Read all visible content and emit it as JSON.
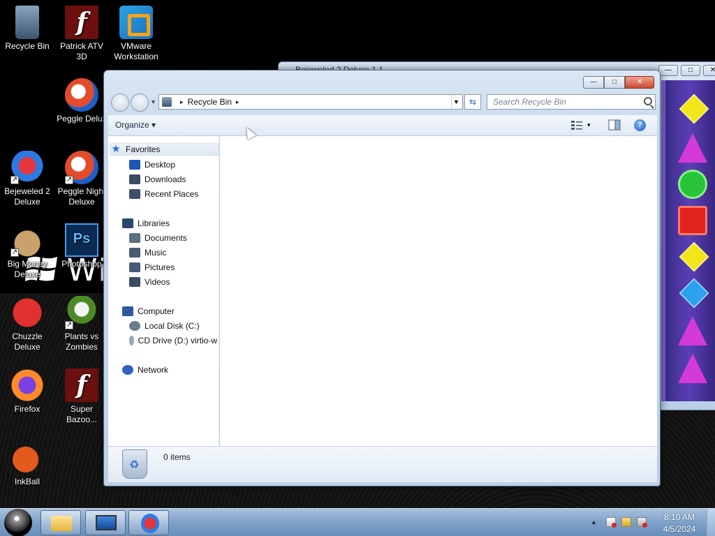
{
  "desktop": {
    "icons": [
      {
        "label": "Recycle Bin",
        "icon": "recycle-bin-icon"
      },
      {
        "label": "Patrick ATV\n3D",
        "icon": "flash-icon"
      },
      {
        "label": "VMware\nWorkstation",
        "icon": "vmware-icon"
      },
      {
        "label": "Peggle Delux",
        "icon": "peggle-icon"
      },
      {
        "label": "Bejeweled 2\nDeluxe",
        "icon": "bejeweled-icon"
      },
      {
        "label": "Peggle Night\nDeluxe",
        "icon": "peggle-icon"
      },
      {
        "label": "Big Money\nDeluxe",
        "icon": "money-bag-icon"
      },
      {
        "label": "Photoshop",
        "icon": "photoshop-icon"
      },
      {
        "label": "Chuzzle\nDeluxe",
        "icon": "chuzzle-icon"
      },
      {
        "label": "Plants vs\nZombies",
        "icon": "plants-vs-zombies-icon"
      },
      {
        "label": "Firefox",
        "icon": "firefox-icon"
      },
      {
        "label": "Super\nBazoo...",
        "icon": "flash-icon"
      },
      {
        "label": "InkBall",
        "icon": "inkball-icon"
      }
    ],
    "wallpaper_text": "Wi"
  },
  "bejeweled_window": {
    "title": "Bejeweled 2 Deluxe 1.1",
    "controls": [
      "—",
      "□",
      "✕"
    ]
  },
  "explorer": {
    "window_controls": {
      "minimize": "—",
      "maximize": "□",
      "close": "✕"
    },
    "address": {
      "crumb": "Recycle Bin",
      "separator": "▸"
    },
    "search_placeholder": "Search Recycle Bin",
    "toolbar": {
      "organize": "Organize ▾",
      "view": "▾",
      "help": "?"
    },
    "nav": {
      "favorites": "Favorites",
      "desktop": "Desktop",
      "downloads": "Downloads",
      "recent": "Recent Places",
      "libraries": "Libraries",
      "documents": "Documents",
      "music": "Music",
      "pictures": "Pictures",
      "videos": "Videos",
      "computer": "Computer",
      "local_disk": "Local Disk (C:)",
      "cd_drive": "CD Drive (D:) virtio-w",
      "network": "Network"
    },
    "details": {
      "item_count": "0 items"
    }
  },
  "taskbar": {
    "clock_time": "8:10 AM",
    "clock_date": "4/5/2024",
    "tray_expand": "▲"
  }
}
